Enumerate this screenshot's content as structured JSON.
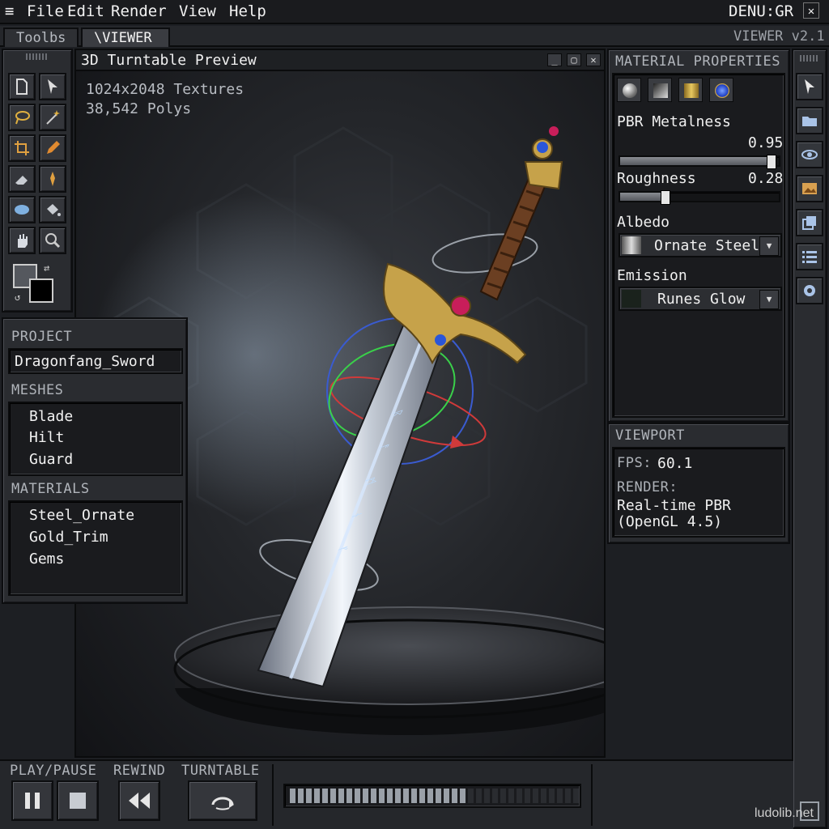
{
  "menubar": {
    "items": [
      "File",
      "Edit",
      "Render",
      "View",
      "Help"
    ],
    "right_label": "DENU:GR"
  },
  "tabs": [
    {
      "label": "Toolbs",
      "active": false
    },
    {
      "label": "\\VIEWER",
      "active": true
    }
  ],
  "version": "VIEWER v2.1",
  "viewer": {
    "title": "3D Turntable Preview",
    "info_textures": "1024x2048 Textures",
    "info_polys": "38,542 Polys"
  },
  "tools": [
    "new-file-icon",
    "select-arrow-icon",
    "lasso-icon",
    "magic-wand-icon",
    "crop-icon",
    "pencil-icon",
    "eraser-icon",
    "pin-icon",
    "ellipse-icon",
    "paint-bucket-icon",
    "hand-icon",
    "zoom-icon"
  ],
  "project": {
    "header": "PROJECT",
    "name": "Dragonfang_Sword",
    "meshes_header": "MESHES",
    "meshes": [
      "Blade",
      "Hilt",
      "Guard"
    ],
    "materials_header": "MATERIALS",
    "materials": [
      "Steel_Ornate",
      "Gold_Trim",
      "Gems"
    ]
  },
  "material_properties": {
    "header": "MATERIAL PROPERTIES",
    "swatch_icons": [
      "sphere-icon",
      "gradient-icon",
      "gold-texture-icon",
      "gem-icon"
    ],
    "metalness_label": "PBR Metalness",
    "metalness_value": "0.95",
    "metalness_fraction": 0.95,
    "roughness_label": "Roughness",
    "roughness_value": "0.28",
    "roughness_fraction": 0.28,
    "albedo_label": "Albedo",
    "albedo_value": "Ornate Steel",
    "emission_label": "Emission",
    "emission_value": "Runes Glow"
  },
  "viewport": {
    "header": "VIEWPORT",
    "fps_label": "FPS:",
    "fps_value": "60.1",
    "render_label": "RENDER:",
    "render_line1": "Real-time PBR",
    "render_line2": "(OpenGL 4.5)"
  },
  "right_toolbar": [
    "cursor-icon",
    "folder-icon",
    "camera-orbit-icon",
    "image-icon",
    "layers-icon",
    "list-icon",
    "settings-gear-icon"
  ],
  "playback": {
    "play_pause_label": "PLAY/PAUSE",
    "rewind_label": "REWIND",
    "turntable_label": "TURNTABLE",
    "progress_fraction": 0.6
  },
  "watermark": "ludolib.net"
}
